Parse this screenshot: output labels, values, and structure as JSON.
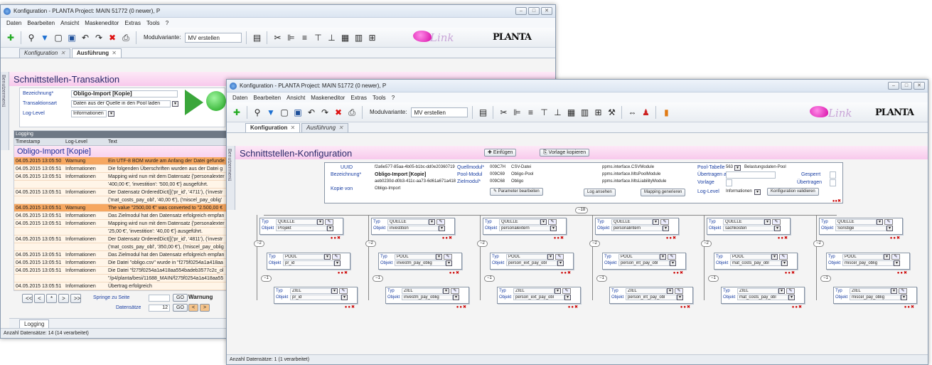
{
  "back": {
    "title": "Konfiguration - PLANTA Project: MAIN 51772  (0 newer), P",
    "menu": [
      "Daten",
      "Bearbeiten",
      "Ansicht",
      "Maskeneditor",
      "Extras",
      "Tools",
      "?"
    ],
    "modul_label": "Modulvariante:",
    "modul_value": "MV erstellen",
    "link": "Link",
    "brand": "PLANTA",
    "tabs": [
      {
        "label": "Konfiguration"
      },
      {
        "label": "Ausführung"
      }
    ],
    "sidebar": "Benutzermenü",
    "header": "Schnittstellen-Transaktion",
    "form": {
      "bez_label": "Bezeichnung*",
      "bez_value": "Obligo-Import [Kopie]",
      "art_label": "Transaktionsart",
      "art_value": "Daten aus der Quelle in den Pool laden",
      "level_label": "Log-Level",
      "level_value": "Informationen"
    },
    "logging": {
      "title": "Logging",
      "cols": [
        "Timestamp",
        "Log-Level",
        "Text"
      ],
      "heading": "Obligo-Import [Kopie]",
      "rows": [
        {
          "ts": "04.05.2015 13:05:50",
          "lvl": "Warnung",
          "txt": "Ein UTF-8 BOM wurde am Anfang der Datei gefunde",
          "w": true
        },
        {
          "ts": "04.05.2015 13:05:51",
          "lvl": "Informationen",
          "txt": "Die folgenden Überschriften wurden aus der Datei g",
          "w": false
        },
        {
          "ts": "04.05.2015 13:05:51",
          "lvl": "Informationen",
          "txt": "Mapping wird nun mit dem Datensatz {'personalexter",
          "w": false
        },
        {
          "ts": "",
          "lvl": "",
          "txt": "'400,00 €', 'investition': '500,00 €'} ausgeführt.",
          "w": false
        },
        {
          "ts": "04.05.2015 13:05:51",
          "lvl": "Informationen",
          "txt": "Der Datensatz OrderedDict([('pr_id', '4711'), ('investr",
          "w": false
        },
        {
          "ts": "",
          "lvl": "",
          "txt": "('mat_costs_pay_obl', '40,00 €'), ('miscel_pay_oblig'",
          "w": false
        },
        {
          "ts": "04.05.2015 13:05:51",
          "lvl": "Warnung",
          "txt": "The value \"2500,00 €\" was converted to \"2.500,00 €",
          "w": true
        },
        {
          "ts": "04.05.2015 13:05:51",
          "lvl": "Informationen",
          "txt": "Das Zielmodul hat den Datensatz erfolgreich empfan",
          "w": false
        },
        {
          "ts": "04.05.2015 13:05:51",
          "lvl": "Informationen",
          "txt": "Mapping wird nun mit dem Datensatz {'personalexter",
          "w": false
        },
        {
          "ts": "",
          "lvl": "",
          "txt": "'25,00 €', 'investition': '40,00 €'} ausgeführt.",
          "w": false
        },
        {
          "ts": "04.05.2015 13:05:51",
          "lvl": "Informationen",
          "txt": "Der Datensatz OrderedDict([('pr_id', '4811'), ('investr",
          "w": false
        },
        {
          "ts": "",
          "lvl": "",
          "txt": "('mat_costs_pay_obl', '350,00 €'), ('miscel_pay_oblig",
          "w": false
        },
        {
          "ts": "04.05.2015 13:05:51",
          "lvl": "Informationen",
          "txt": "Das Zielmodul hat den Datensatz erfolgreich empfan",
          "w": false
        },
        {
          "ts": "04.05.2015 13:05:51",
          "lvl": "Informationen",
          "txt": "Die Datei \"obligo.csv\" wurde in \"f275f0254a1a418aa",
          "w": false
        },
        {
          "ts": "04.05.2015 13:05:51",
          "lvl": "Informationen",
          "txt": "Die Datei \"f275f0254a1a418aa554badeb3577c2c_ol",
          "w": false
        },
        {
          "ts": "",
          "lvl": "",
          "txt": "\"/p4/planta/besi/11688_MAIN/f275f0254a1a418aa55",
          "w": false
        },
        {
          "ts": "04.05.2015 13:05:51",
          "lvl": "Informationen",
          "txt": "Übertrag erfolgreich",
          "w": false
        }
      ]
    },
    "nav": {
      "buttons": [
        "<<",
        "<",
        "*",
        ">",
        ">>"
      ],
      "springe": "Springe zu Seite",
      "go": "GO",
      "warnung": "Warnung",
      "datensaetze": "Datensätze",
      "ds_value": "12"
    },
    "bottom_tab": "Logging",
    "status": "Anzahl Datensätze: 14 (14 verarbeitet)"
  },
  "front": {
    "title": "Konfiguration - PLANTA Project: MAIN 51772  (0 newer), P",
    "menu": [
      "Daten",
      "Bearbeiten",
      "Ansicht",
      "Maskeneditor",
      "Extras",
      "Tools",
      "?"
    ],
    "modul_label": "Modulvariante:",
    "modul_value": "MV erstellen",
    "link": "Link",
    "brand": "PLANTA",
    "tabs": [
      {
        "label": "Konfiguration"
      },
      {
        "label": "Ausführung"
      }
    ],
    "sidebar": "Benutzermenü",
    "header": "Schnittstellen-Konfiguration",
    "btn_einfuegen": "Einfügen",
    "btn_vorlage": "Vorlage kopieren",
    "config": {
      "uuid_label": "UUID",
      "uuid": "f2a6e577-85aa-4b05-b1bc-dd0e20360719",
      "bez_label": "Bezeichnung*",
      "bez": "Obligo-Import [Kopie]",
      "kopie_uuid": "aeb0230d-d0b3-411c-aa73-6d61a671a418",
      "kopie_label": "Kopie von",
      "kopie": "Obligo-Import",
      "quell_label": "Quellmodul*",
      "quell_id": "009C7H",
      "quell_name": "CSV-Datei",
      "quell_cls": "ppms.interface.CSVModule",
      "pool_label": "Pool-Modul",
      "pool_id": "009C69",
      "pool_name": "Obligo-Pool",
      "pool_cls": "ppms.interface.MtsPoolModule",
      "ziel_label": "Zielmodul*",
      "ziel_id": "009C68",
      "ziel_name": "Obligo",
      "ziel_cls": "ppms.interface.MtsLiabilityModule",
      "pooltab_label": "Pool-Tabelle",
      "pooltab_id": "563",
      "pooltab_name": "Belastungsdaten-Pool",
      "uebertragen_am": "Übertragen am",
      "gesperrt": "Gesperrt",
      "vorlage": "Vorlage",
      "uebertragen": "Übertragen",
      "loglevel": "Log-Level",
      "loglevel_value": "Informationen",
      "btn_param": "Parameter bearbeiten",
      "btn_log": "Log ansehen",
      "btn_mapping": "Mapping generieren",
      "btn_validieren": "Konfiguration validieren"
    },
    "tree_count": "18",
    "columns": [
      {
        "quelle": "Projekt",
        "pool": "pr_id",
        "ziel": "pr_id"
      },
      {
        "quelle": "investition",
        "pool": "investm_pay_oblig",
        "ziel": "investm_pay_oblig"
      },
      {
        "quelle": "personalextern",
        "pool": "person_ext_pay_obl",
        "ziel": "person_ext_pay_obl"
      },
      {
        "quelle": "personalintern",
        "pool": "person_int_pay_obl",
        "ziel": "person_int_pay_obl"
      },
      {
        "quelle": "sachkosten",
        "pool": "mat_costs_pay_obl",
        "ziel": "mat_costs_pay_obl"
      },
      {
        "quelle": "Sonstige",
        "pool": "miscel_pay_oblig",
        "ziel": "miscel_pay_oblig"
      }
    ],
    "typ_label": "Typ",
    "obj_label": "Objekt",
    "types": {
      "q": "QUELLE",
      "p": "POOL",
      "z": "ZIEL"
    },
    "count2": "2",
    "count1": "1",
    "status": "Anzahl Datensätze: 1 (1 verarbeitet)"
  }
}
